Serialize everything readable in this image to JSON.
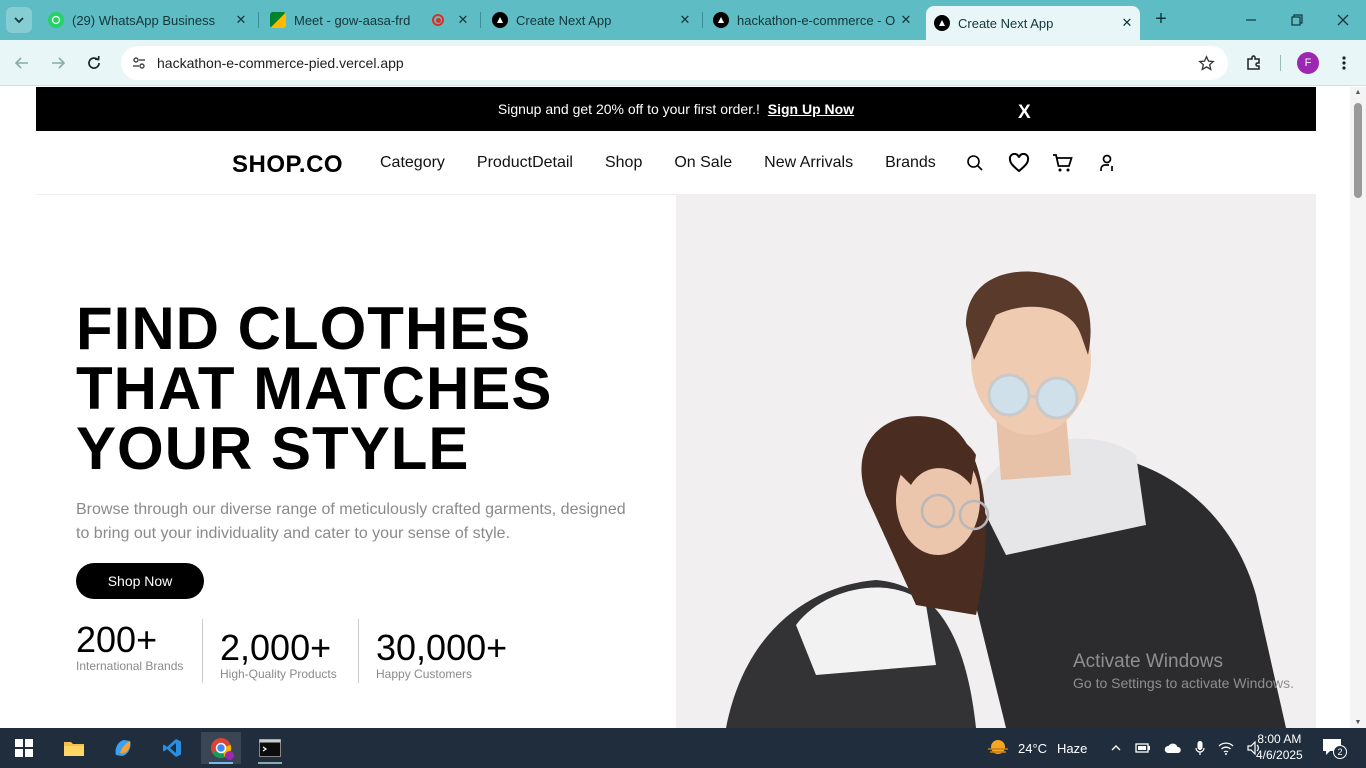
{
  "browser": {
    "tabs": [
      {
        "title": "(29) WhatsApp Business",
        "favicon": "whatsapp-icon"
      },
      {
        "title": "Meet - gow-aasa-frd",
        "favicon": "google-meet-icon",
        "recording": true
      },
      {
        "title": "Create Next App",
        "favicon": "vercel-icon"
      },
      {
        "title": "hackathon-e-commerce - O",
        "favicon": "vercel-icon"
      },
      {
        "title": "Create Next App",
        "favicon": "vercel-icon",
        "active": true
      }
    ],
    "url": "hackathon-e-commerce-pied.vercel.app",
    "profile_initial": "F",
    "accent_color": "#5ebcc4"
  },
  "promo": {
    "message": "Signup and get 20% off to your first order.!",
    "link": "Sign Up Now",
    "close": "X"
  },
  "header": {
    "logo": "SHOP.CO",
    "nav": [
      "Category",
      "ProductDetail",
      "Shop",
      "On Sale",
      "New Arrivals",
      "Brands"
    ]
  },
  "hero": {
    "headline": [
      "FIND CLOTHES",
      "THAT MATCHES",
      "YOUR STYLE"
    ],
    "subtitle": "Browse through our diverse range of meticulously crafted garments, designed to bring out your individuality and cater to your sense of style.",
    "cta": "Shop Now",
    "stats": [
      {
        "value": "200+",
        "label": "International Brands"
      },
      {
        "value": "2,000+",
        "label": "High-Quality Products"
      },
      {
        "value": "30,000+",
        "label": "Happy Customers"
      }
    ]
  },
  "watermark": {
    "line1": "Activate Windows",
    "line2": "Go to Settings to activate Windows."
  },
  "taskbar": {
    "weather_temp": "24°C",
    "weather_desc": "Haze",
    "time": "8:00 AM",
    "date": "4/6/2025",
    "notifications": "2"
  }
}
